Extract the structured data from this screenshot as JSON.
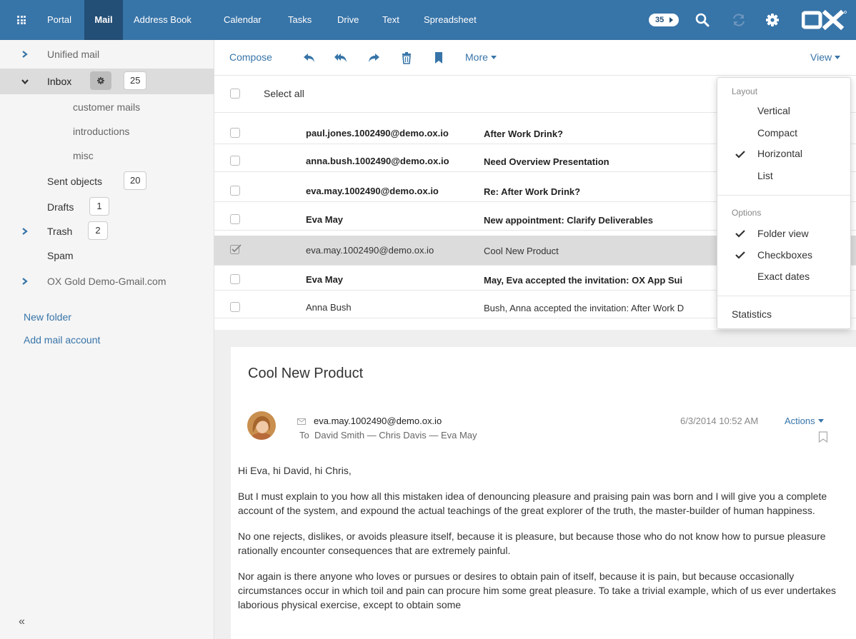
{
  "top_nav": {
    "tabs": [
      "Portal",
      "Mail",
      "Address Book",
      "Calendar",
      "Tasks",
      "Drive",
      "Text",
      "Spreadsheet"
    ],
    "active_tab": "Mail",
    "notification_count": "35",
    "logo_text": "OX",
    "icons": [
      "apps-grid-icon",
      "search-icon",
      "refresh-icon",
      "gear-icon"
    ],
    "colors": {
      "bar": "#3774a8",
      "active_tab": "#234e75"
    }
  },
  "sidebar": {
    "folders": {
      "unified": {
        "label": "Unified mail"
      },
      "inbox": {
        "label": "Inbox",
        "count": "25"
      },
      "customer_mails": {
        "label": "customer mails"
      },
      "introductions": {
        "label": "introductions"
      },
      "misc": {
        "label": "misc"
      },
      "sent": {
        "label": "Sent objects",
        "count": "20"
      },
      "drafts": {
        "label": "Drafts",
        "count": "1"
      },
      "trash": {
        "label": "Trash",
        "count": "2"
      },
      "spam": {
        "label": "Spam"
      },
      "gmail": {
        "label": "OX Gold Demo-Gmail.com"
      }
    },
    "new_folder": "New folder",
    "add_account": "Add mail account",
    "collapse_glyph": "«"
  },
  "toolbar": {
    "compose": "Compose",
    "more": "More",
    "view": "View",
    "icons": [
      "reply-icon",
      "reply-all-icon",
      "forward-icon",
      "trash-icon",
      "bookmark-icon"
    ]
  },
  "mail_list": {
    "select_all": "Select all",
    "rows": [
      {
        "from": "paul.jones.1002490@demo.ox.io",
        "subject": "After Work Drink?",
        "unread": true,
        "selected": false
      },
      {
        "from": "anna.bush.1002490@demo.ox.io",
        "subject": "Need Overview Presentation",
        "unread": true,
        "selected": false
      },
      {
        "from": "eva.may.1002490@demo.ox.io",
        "subject": "Re: After Work Drink?",
        "unread": true,
        "selected": false
      },
      {
        "from": "Eva May",
        "subject": "New appointment: Clarify Deliverables",
        "unread": true,
        "selected": false
      },
      {
        "from": "eva.may.1002490@demo.ox.io",
        "subject": "Cool New Product",
        "unread": false,
        "selected": true
      },
      {
        "from": "Eva May",
        "subject": "May, Eva accepted the invitation: OX App Sui",
        "unread": true,
        "selected": false
      },
      {
        "from": "Anna Bush",
        "subject": "Bush, Anna accepted the invitation: After Work D",
        "unread": false,
        "selected": false
      }
    ]
  },
  "detail": {
    "subject": "Cool New Product",
    "from": "eva.may.1002490@demo.ox.io",
    "to_label": "To",
    "recipients": "David Smith — Chris Davis — Eva May",
    "date": "6/3/2014 10:52 AM",
    "actions": "Actions",
    "body": [
      "Hi Eva, hi David, hi Chris,",
      "But I must explain to you how all this mistaken idea of denouncing pleasure and praising pain was born and I will give you a complete account of the system, and expound the actual teachings of the great explorer of the truth, the master-builder of human happiness.",
      "No one rejects, dislikes, or avoids pleasure itself, because it is pleasure, but because those who do not know how to pursue pleasure rationally encounter consequences that are extremely painful.",
      "Nor again is there anyone who loves or pursues or desires to obtain pain of itself, because it is pain, but because occasionally circumstances occur in which toil and pain can procure him some great pleasure. To take a trivial example, which of us ever undertakes laborious physical exercise, except to obtain some"
    ]
  },
  "view_menu": {
    "layout_header": "Layout",
    "layout": [
      {
        "label": "Vertical",
        "checked": false
      },
      {
        "label": "Compact",
        "checked": false
      },
      {
        "label": "Horizontal",
        "checked": true
      },
      {
        "label": "List",
        "checked": false
      }
    ],
    "options_header": "Options",
    "options": [
      {
        "label": "Folder view",
        "checked": true
      },
      {
        "label": "Checkboxes",
        "checked": true
      },
      {
        "label": "Exact dates",
        "checked": false
      }
    ],
    "statistics": "Statistics"
  }
}
